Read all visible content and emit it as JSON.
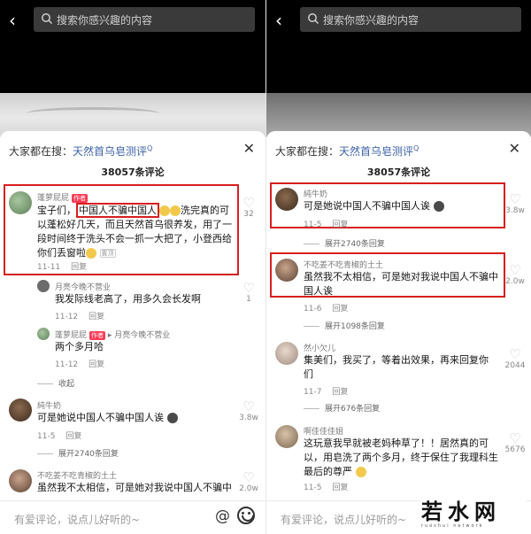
{
  "left": {
    "search_placeholder": "搜索你感兴趣的内容",
    "hint_prefix": "大家都在搜：",
    "hint_keyword": "天然首乌皂测评",
    "comment_count": "38057条评论",
    "comments": [
      {
        "user": "蓬萝屁屁",
        "tag": "作者",
        "text_pre": "宝子们，",
        "text_box": "中国人不骗中国人",
        "text_post": "洗完真的可以蓬松好几天，而且天然首乌很养发，用了一段时间终于洗头不会一抓一大把了，小登西给你们丢窗啦",
        "date": "11-11",
        "reply": "回复",
        "likes": "32",
        "mini": "置顶"
      },
      {
        "user": "月亮今晚不营业",
        "text": "我发际线老高了，用多久会长发啊",
        "date": "11-12",
        "reply": "回复",
        "likes": "1"
      },
      {
        "user": "蓬萝屁屁",
        "tag": "作者",
        "reply_to": "月亮今晚不营业",
        "text": "两个多月哈",
        "date": "11-12",
        "reply": "回复"
      },
      {
        "collapse": "收起"
      },
      {
        "user": "純牛奶",
        "text": "可是她说中国人不骗中国人诶",
        "date": "11-5",
        "reply": "回复",
        "likes": "3.8w"
      },
      {
        "expand": "展开2740条回复"
      },
      {
        "user": "不吃姜不吃青椒的土土",
        "text": "虽然我不太相信，可是她对我说中国人不骗中",
        "likes": "2.0w"
      }
    ],
    "input_placeholder": "有爱评论，说点儿好听的~",
    "at_symbol": "@"
  },
  "right": {
    "search_placeholder": "搜索你感兴趣的内容",
    "hint_prefix": "大家都在搜：",
    "hint_keyword": "天然首乌皂测评",
    "comment_count": "38057条评论",
    "comments": [
      {
        "user": "純牛奶",
        "text": "可是她说中国人不骗中国人诶",
        "date": "11-5",
        "reply": "回复",
        "likes": "3.8w"
      },
      {
        "expand": "展开2740条回复"
      },
      {
        "user": "不吃姜不吃青椒的土土",
        "text": "虽然我不太相信，可是她对我说中国人不骗中国人诶",
        "date": "11-6",
        "reply": "回复",
        "likes": "2.0w"
      },
      {
        "expand": "展开1098条回复"
      },
      {
        "user": "然小欠儿",
        "text": "集美们，我买了，等着出效果，再来回复你们",
        "date": "11-7",
        "reply": "回复",
        "likes": "2044"
      },
      {
        "expand": "展开676条回复"
      },
      {
        "user": "啊佳佳佳姐",
        "text": "这玩意我早就被老妈种草了！！居然真的可以，用皂洗了两个多月，终于保住了我理科生最后的尊严",
        "date": "11-5",
        "reply": "回复",
        "likes": "5676"
      }
    ],
    "input_placeholder": "有爱评论，说点儿好听的~"
  },
  "watermark": {
    "text": "若水网",
    "sub": "ruoshui network"
  },
  "colors": {
    "highlight_box": "#d71f1f",
    "author_tag": "#ff3b56",
    "keyword_blue": "#3d63a8"
  }
}
